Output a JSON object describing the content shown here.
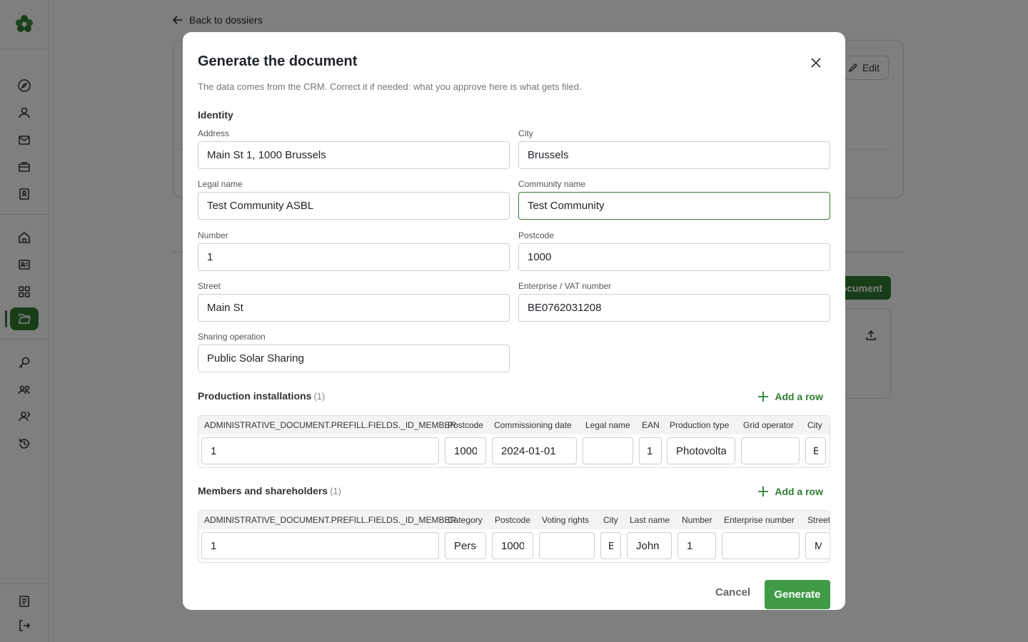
{
  "background": {
    "back_link": "Back to dossiers",
    "edit_label": "Edit",
    "generate_partial_label": "ocument"
  },
  "modal": {
    "title": "Generate the document",
    "intro_text": "The data comes from the CRM. Correct it if needed: what you approve here is what gets filed.",
    "identity": {
      "section_title": "Identity",
      "fields": {
        "address": {
          "label": "Address",
          "value": "Main St 1, 1000 Brussels"
        },
        "city": {
          "label": "City",
          "value": "Brussels"
        },
        "legal_name": {
          "label": "Legal name",
          "value": "Test Community ASBL"
        },
        "community_name": {
          "label": "Community name",
          "value": "Test Community"
        },
        "number": {
          "label": "Number",
          "value": "1"
        },
        "postcode": {
          "label": "Postcode",
          "value": "1000"
        },
        "street": {
          "label": "Street",
          "value": "Main St"
        },
        "enterprise_vat": {
          "label": "Enterprise / VAT number",
          "value": "BE0762031208"
        },
        "sharing_operation": {
          "label": "Sharing operation",
          "value": "Public Solar Sharing"
        }
      }
    },
    "production": {
      "title": "Production installations",
      "count": "(1)",
      "add_row": "Add a row",
      "columns": [
        "ADMINISTRATIVE_DOCUMENT.PREFILL.FIELDS._ID_MEMBER",
        "Postcode",
        "Commissioning date",
        "Legal name",
        "EAN",
        "Production type",
        "Grid operator",
        "City"
      ],
      "row": [
        "1",
        "1000",
        "2024-01-01",
        "",
        "1",
        "Photovoltaic",
        "",
        "Brussels"
      ]
    },
    "members": {
      "title": "Members and shareholders",
      "count": "(1)",
      "add_row": "Add a row",
      "columns": [
        "ADMINISTRATIVE_DOCUMENT.PREFILL.FIELDS._ID_MEMBER",
        "Category",
        "Postcode",
        "Voting rights",
        "City",
        "Last name",
        "Number",
        "Enterprise number",
        "Street"
      ],
      "row": [
        "1",
        "Person",
        "1000",
        "",
        "Brussels",
        "John",
        "1",
        "",
        "Main St"
      ]
    },
    "footer": {
      "cancel": "Cancel",
      "generate": "Generate"
    }
  },
  "colors": {
    "accent": "#2e7d32",
    "generate_button": "#3f9b45",
    "overlay": "rgba(0,0,0,0.5)"
  },
  "icons": [
    "logo-icon",
    "compass-icon",
    "user-icon",
    "mail-icon",
    "briefcase-icon",
    "contact-book-icon",
    "home-icon",
    "id-card-icon",
    "grid-icon",
    "folder-open-icon",
    "search-key-icon",
    "group-icon",
    "team-icon",
    "history-icon",
    "document-icon",
    "logout-icon",
    "arrow-left-icon",
    "close-icon",
    "plus-icon",
    "pencil-icon",
    "upload-icon"
  ]
}
